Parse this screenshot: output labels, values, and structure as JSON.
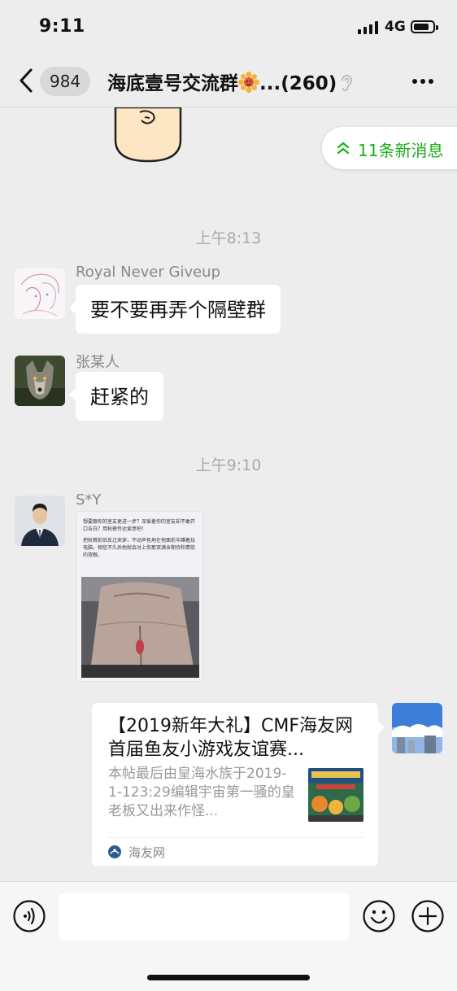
{
  "status_bar": {
    "time": "9:11",
    "network": "4G"
  },
  "nav": {
    "unread_count": "984",
    "title": "海底壹号交流群",
    "title_suffix": "...",
    "member_count": "(260)"
  },
  "new_messages": {
    "label": "11条新消息"
  },
  "messages": [
    {
      "type": "time",
      "text": "上午8:13"
    },
    {
      "type": "text",
      "sender": "Royal Never Giveup",
      "text": "要不要再弄个隔壁群"
    },
    {
      "type": "text",
      "sender": "张某人",
      "text": "赶紧的"
    },
    {
      "type": "time",
      "text": "上午9:10"
    },
    {
      "type": "image",
      "sender": "S*Y",
      "image_text": [
        "想要跟你的室友更进一步？深爱着你的室友却不敢开口告白？用秋裤传达爱意吧！",
        "把秋裤前后反过来穿，不动声色地在他面前半蹲着玩电脑，相信不久后他就会对上你那双满含期待和情慾的双眼。"
      ]
    },
    {
      "type": "link",
      "title": "【2019新年大礼】CMF海友网首届鱼友小游戏友谊赛...",
      "description": "本帖最后由皇海水族于2019-1-123:29编辑宇宙第一骚的皇老板又出来作怪...",
      "source": "海友网"
    }
  ],
  "colors": {
    "background": "#ededed",
    "accent_green": "#1aad19",
    "bubble": "#ffffff",
    "meta_text": "#aaaaaa"
  },
  "icons": {
    "back": "chevron-left-icon",
    "title_emoji": "sunflower-emoji-icon",
    "ear": "ear-icon",
    "more": "more-dots-icon",
    "new_msgs": "double-chevron-up-icon",
    "voice": "voice-icon",
    "emoji": "smiley-icon",
    "plus": "plus-icon",
    "link_source": "site-logo-icon"
  }
}
